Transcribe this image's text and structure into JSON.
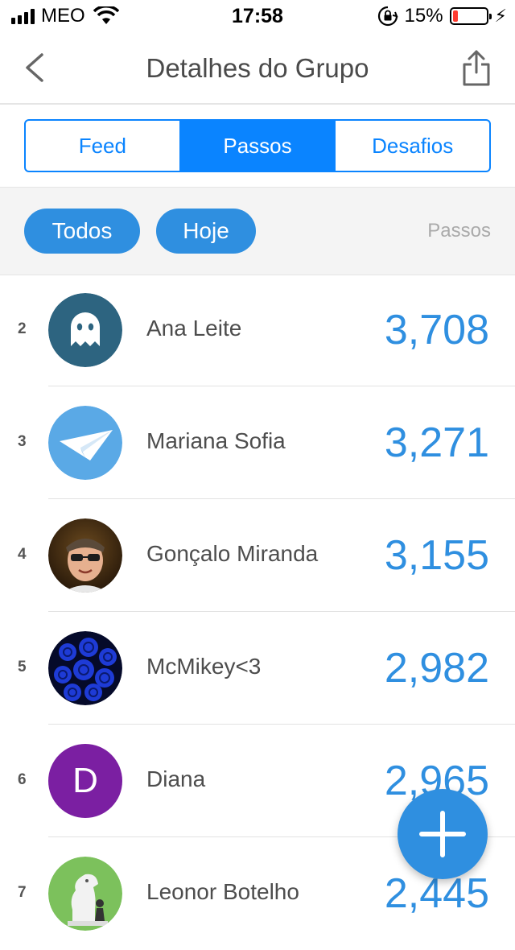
{
  "status_bar": {
    "carrier": "MEO",
    "time": "17:58",
    "battery_percent": "15%",
    "battery_level": 0.15,
    "icons": [
      "signal-icon",
      "wifi-icon",
      "rotation-lock-icon",
      "battery-icon",
      "charging-bolt-icon"
    ]
  },
  "nav": {
    "title": "Detalhes do Grupo",
    "back_icon": "chevron-left-icon",
    "share_icon": "share-icon"
  },
  "tabs": [
    {
      "label": "Feed",
      "active": false
    },
    {
      "label": "Passos",
      "active": true
    },
    {
      "label": "Desafios",
      "active": false
    }
  ],
  "filters": {
    "todos": "Todos",
    "hoje": "Hoje",
    "column_label": "Passos"
  },
  "leaderboard": [
    {
      "rank": "2",
      "name": "Ana Leite",
      "steps": "3,708",
      "avatar": "ghost-avatar"
    },
    {
      "rank": "3",
      "name": "Mariana Sofia",
      "steps": "3,271",
      "avatar": "paper-plane-avatar"
    },
    {
      "rank": "4",
      "name": "Gonçalo Miranda",
      "steps": "3,155",
      "avatar": "photo-avatar"
    },
    {
      "rank": "5",
      "name": "McMikey<3",
      "steps": "2,982",
      "avatar": "blue-roses-avatar"
    },
    {
      "rank": "6",
      "name": "Diana",
      "steps": "2,965",
      "avatar": "letter-avatar",
      "initial": "D"
    },
    {
      "rank": "7",
      "name": "Leonor Botelho",
      "steps": "2,445",
      "avatar": "chess-avatar"
    }
  ],
  "fab": {
    "icon": "plus-icon"
  },
  "colors": {
    "accent": "#0a84ff",
    "pill": "#2f8fe0",
    "steps": "#2f8fe0",
    "ghost_bg": "#2d6480",
    "plane_bg": "#5aa9e6",
    "letter_bg": "#7b1fa2",
    "chess_bg": "#7cc15c"
  }
}
